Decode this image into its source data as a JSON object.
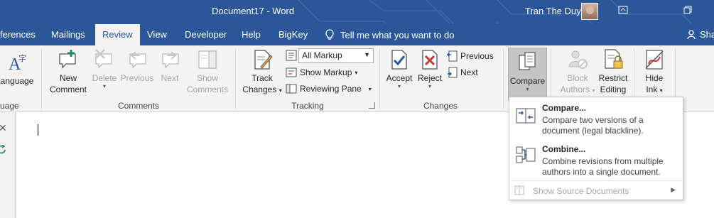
{
  "title_bar": {
    "document_title": "Document17  -  Word",
    "user_name": "Tran The Duy",
    "window_buttons": [
      "ribbon-display-options-icon",
      "restore-icon"
    ]
  },
  "tabs": {
    "references": "ferences",
    "mailings": "Mailings",
    "review": "Review",
    "view": "View",
    "developer": "Developer",
    "help": "Help",
    "bigkey": "BigKey",
    "tell_me": "Tell me what you want to do",
    "share": "Sha"
  },
  "ribbon": {
    "language": {
      "button_label": "Language",
      "group_label": "uage"
    },
    "comments": {
      "new": "New",
      "comment": "Comment",
      "delete": "Delete",
      "previous": "Previous",
      "next": "Next",
      "show": "Show",
      "comments": "Comments",
      "group_label": "Comments"
    },
    "tracking": {
      "track": "Track",
      "changes": "Changes",
      "markup_dropdown": "All Markup",
      "show_markup": "Show Markup",
      "reviewing_pane": "Reviewing Pane",
      "group_label": "Tracking"
    },
    "changes": {
      "accept": "Accept",
      "reject": "Reject",
      "previous": "Previous",
      "next": "Next",
      "group_label": "Changes"
    },
    "compare": {
      "label": "Compare"
    },
    "protect": {
      "block": "Block",
      "authors": "Authors",
      "restrict": "Restrict",
      "editing": "Editing"
    },
    "ink": {
      "hide": "Hide",
      "ink": "Ink"
    }
  },
  "compare_menu": {
    "compare_title": "Compare...",
    "compare_desc": "Compare two versions of a document (legal blackline).",
    "combine_title": "Combine...",
    "combine_desc": "Combine revisions from multiple authors into a single document.",
    "show_source": "Show Source Documents"
  },
  "colors": {
    "title_bar": "#2b579a",
    "ribbon_bg": "#f3f3f3",
    "active_button": "#c5c5c5"
  }
}
